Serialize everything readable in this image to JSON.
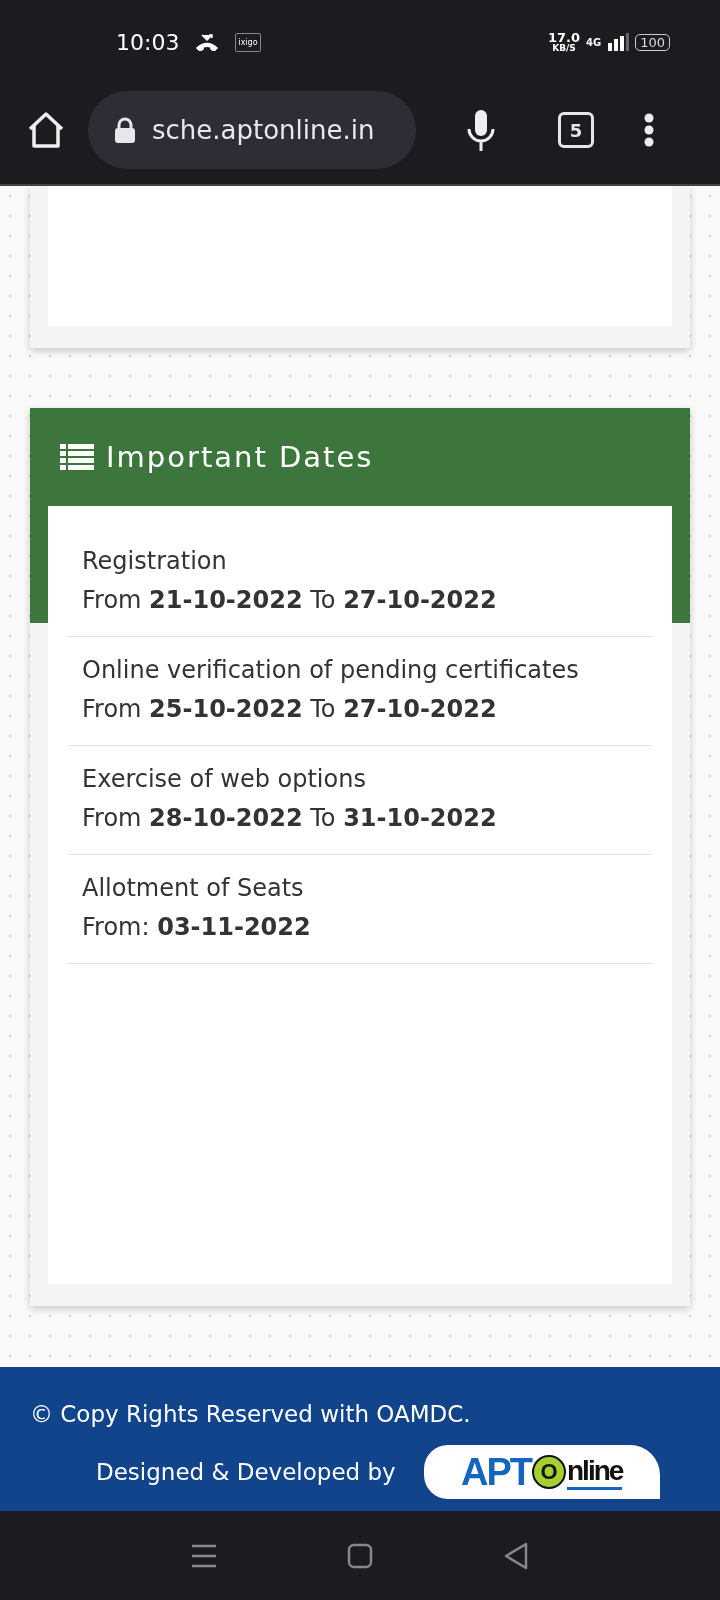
{
  "status_bar": {
    "time": "10:03",
    "app_badge": "ixigo",
    "speed": "17.0",
    "speed_unit": "KB/S",
    "network": "4G",
    "battery": "100"
  },
  "browser": {
    "url": "sche.aptonline.in",
    "tab_count": "5"
  },
  "important_dates": {
    "title": "Important Dates",
    "items": [
      {
        "label": "Registration",
        "dates": "From **21-10-2022** To **27-10-2022**"
      },
      {
        "label": "Online verification of pending certificates",
        "dates": "From **25-10-2022** To **27-10-2022**"
      },
      {
        "label": "Exercise of web options",
        "dates": "From **28-10-2022** To **31-10-2022**"
      },
      {
        "label": "Allotment of Seats",
        "dates": "From: **03-11-2022**"
      }
    ]
  },
  "footer": {
    "copyright": "© Copy Rights Reserved with OAMDC.",
    "designed_by": "Designed & Developed by",
    "logo_parts": [
      "APT",
      "O",
      "nline"
    ]
  }
}
